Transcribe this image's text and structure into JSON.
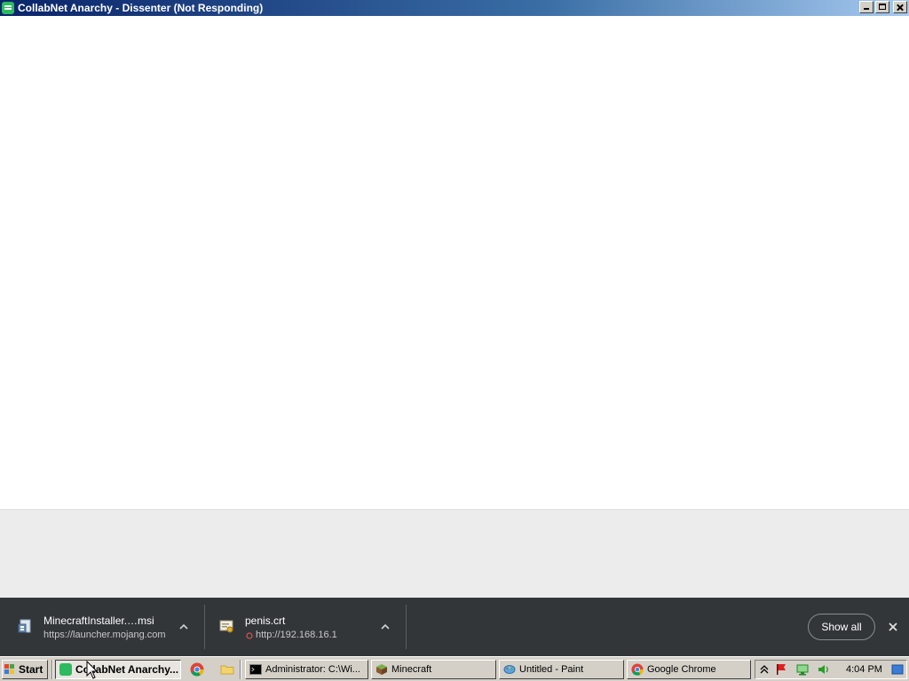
{
  "window": {
    "title": "CollabNet Anarchy - Dissenter (Not Responding)",
    "icon": "spotify-like-green-icon"
  },
  "downloads": {
    "items": [
      {
        "name": "MinecraftInstaller.…msi",
        "url": "https://launcher.mojang.com",
        "icon": "installer-icon"
      },
      {
        "name": "penis.crt",
        "url": "http://192.168.16.1",
        "icon": "certificate-icon"
      }
    ],
    "show_all_label": "Show all",
    "close_icon": "close-icon"
  },
  "taskbar": {
    "start_label": "Start",
    "tasks": [
      {
        "label": "CollabNet Anarchy...",
        "active": true,
        "icon": "green-app-icon"
      },
      {
        "label": "Administrator: C:\\Wi...",
        "active": false,
        "icon": "cmd-icon"
      },
      {
        "label": "Minecraft",
        "active": false,
        "icon": "minecraft-icon"
      },
      {
        "label": "Untitled - Paint",
        "active": false,
        "icon": "paint-icon"
      },
      {
        "label": "Google Chrome",
        "active": false,
        "icon": "chrome-icon"
      }
    ],
    "quicklaunch": [
      "chrome-icon",
      "folder-icon"
    ],
    "clock": "4:04 PM"
  },
  "colors": {
    "titlebar_start": "#0a246a",
    "titlebar_end": "#a6caf0",
    "download_bar": "#323639",
    "taskbar": "#d4d0c8"
  }
}
